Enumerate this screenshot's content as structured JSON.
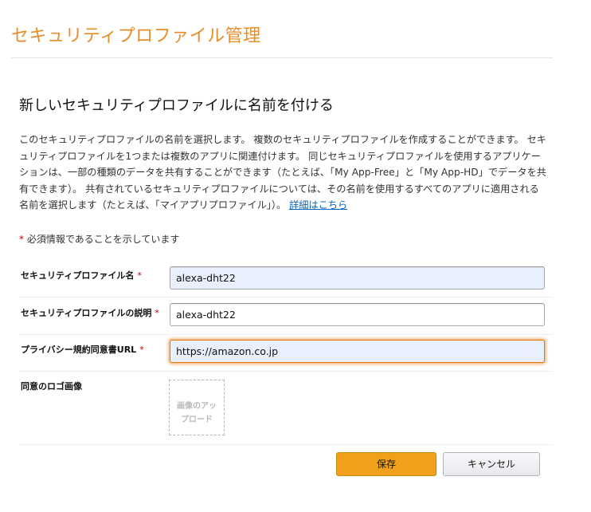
{
  "header": {
    "title": "セキュリティプロファイル管理"
  },
  "section": {
    "heading": "新しいセキュリティプロファイルに名前を付ける",
    "description": "このセキュリティプロファイルの名前を選択します。 複数のセキュリティプロファイルを作成することができます。 セキュリティプロファイルを1つまたは複数のアプリに関連付けます。 同じセキュリティプロファイルを使用するアプリケーションは、一部の種類のデータを共有することができます（たとえば、「My App-Free」と「My App-HD」でデータを共有できます）。 共有されているセキュリティプロファイルについては、その名前を使用するすべてのアプリに適用される名前を選択します（たとえば、「マイアプリプロファイル」）。",
    "learn_more_link": "詳細はこちら",
    "required_star": "*",
    "required_note": " 必須情報であることを示しています"
  },
  "form": {
    "name_label": "セキュリティプロファイル名",
    "name_value": "alexa-dht22",
    "description_label": "セキュリティプロファイルの説明",
    "description_value": "alexa-dht22",
    "privacy_label": "プライバシー規約同意書URL",
    "privacy_value": "https://amazon.co.jp",
    "required_star": "*",
    "logo_label": "同意のロゴ画像",
    "logo_upload_text": "画像のアップロード"
  },
  "actions": {
    "save_label": "保存",
    "cancel_label": "キャンセル"
  },
  "colors": {
    "title_accent": "#e88e29",
    "save_button": "#f0a01a",
    "link": "#0066c0",
    "required": "#c40000",
    "input_fill": "#e8f0fe",
    "focus_border": "#e77600"
  }
}
